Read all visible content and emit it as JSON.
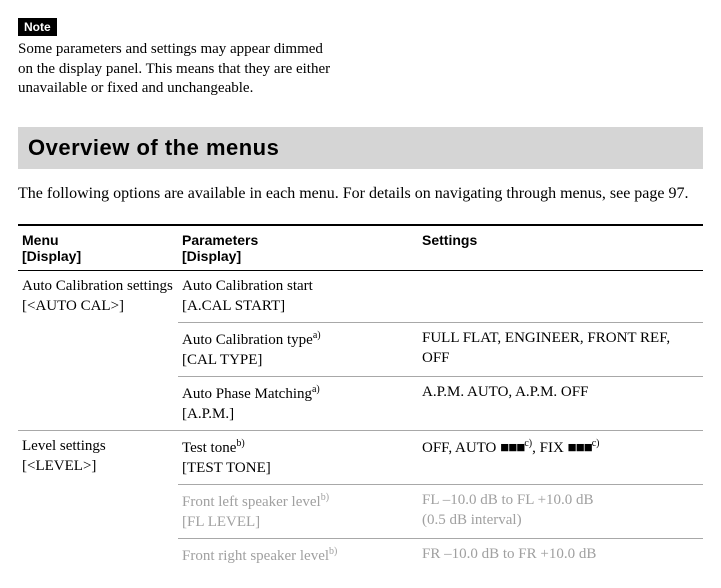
{
  "note": {
    "badge": "Note",
    "text": "Some parameters and settings may appear dimmed on the display panel. This means that they are either unavailable or fixed and unchangeable."
  },
  "section_header": "Overview of the menus",
  "intro": "The following options are available in each menu. For details on navigating through menus, see page 97.",
  "table": {
    "headers": {
      "menu_l1": "Menu",
      "menu_l2": "[Display]",
      "param_l1": "Parameters",
      "param_l2": "[Display]",
      "settings": "Settings"
    },
    "rows": {
      "r1": {
        "menu_l1": "Auto Calibration settings",
        "menu_l2": "[<AUTO CAL>]",
        "param_l1": "Auto Calibration start",
        "param_l2": "[A.CAL START]",
        "setting": ""
      },
      "r2": {
        "param_l1": "Auto Calibration type",
        "sup": "a)",
        "param_l2": "[CAL TYPE]",
        "setting": "FULL FLAT, ENGINEER, FRONT REF, OFF"
      },
      "r3": {
        "param_l1": "Auto Phase Matching",
        "sup": "a)",
        "param_l2": "[A.P.M.]",
        "setting": "A.P.M. AUTO, A.P.M. OFF"
      },
      "r4": {
        "menu_l1": "Level settings",
        "menu_l2": "[<LEVEL>]",
        "param_l1": "Test tone",
        "sup": "b)",
        "param_l2": "[TEST TONE]",
        "setting_pre1": "OFF, AUTO ",
        "blk1": "■■■",
        "sup1": "c)",
        "mid": ", FIX ",
        "blk2": "■■■",
        "sup2": "c)"
      },
      "r5": {
        "param_l1": "Front left speaker level",
        "sup": "b)",
        "param_l2": "[FL LEVEL]",
        "setting_l1": "FL –10.0 dB to FL +10.0 dB",
        "setting_l2": "(0.5 dB interval)"
      },
      "r6": {
        "param_l1": "Front right speaker level",
        "sup": "b)",
        "setting": "FR –10.0 dB to FR +10.0 dB"
      }
    }
  }
}
